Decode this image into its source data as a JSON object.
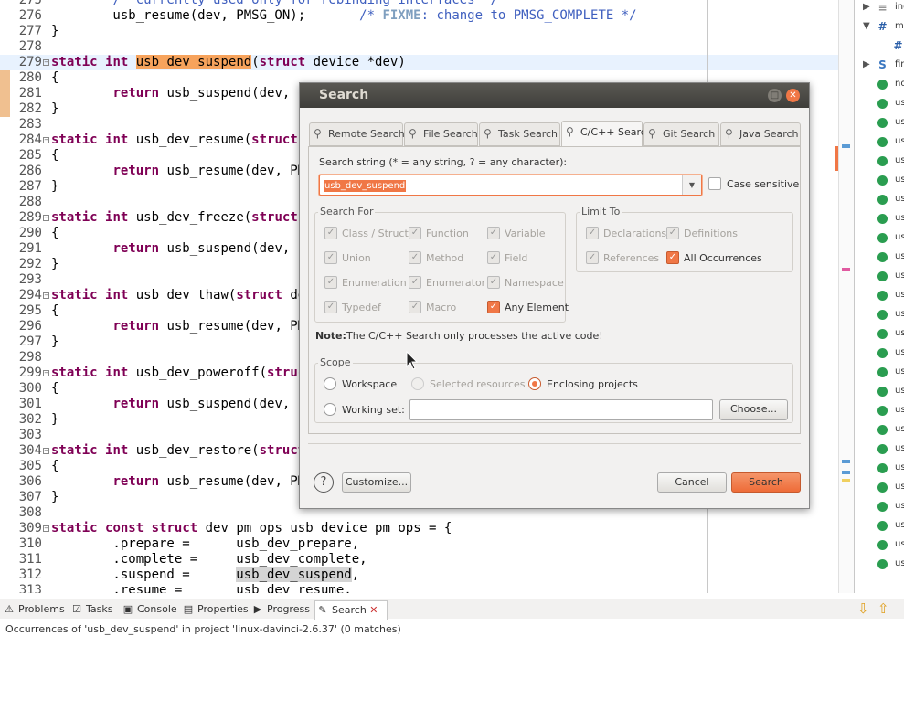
{
  "editor": {
    "lines": [
      {
        "n": "275",
        "code": "        /* currently used only for rebinding interfaces */"
      },
      {
        "n": "276",
        "code": "        usb_resume(dev, PMSG_ON);       /* FIXME: change to PMSG_COMPLETE */"
      },
      {
        "n": "277",
        "code": "}"
      },
      {
        "n": "278",
        "code": ""
      },
      {
        "n": "279",
        "code": "static int usb_dev_suspend(struct device *dev)"
      },
      {
        "n": "280",
        "code": "{"
      },
      {
        "n": "281",
        "code": "        return usb_suspend(dev, PM"
      },
      {
        "n": "282",
        "code": "}"
      },
      {
        "n": "283",
        "code": ""
      },
      {
        "n": "284",
        "code": "static int usb_dev_resume(struct d"
      },
      {
        "n": "285",
        "code": "{"
      },
      {
        "n": "286",
        "code": "        return usb_resume(dev, PMS"
      },
      {
        "n": "287",
        "code": "}"
      },
      {
        "n": "288",
        "code": ""
      },
      {
        "n": "289",
        "code": "static int usb_dev_freeze(struct d"
      },
      {
        "n": "290",
        "code": "{"
      },
      {
        "n": "291",
        "code": "        return usb_suspend(dev, PM"
      },
      {
        "n": "292",
        "code": "}"
      },
      {
        "n": "293",
        "code": ""
      },
      {
        "n": "294",
        "code": "static int usb_dev_thaw(struct dev"
      },
      {
        "n": "295",
        "code": "{"
      },
      {
        "n": "296",
        "code": "        return usb_resume(dev, PMS"
      },
      {
        "n": "297",
        "code": "}"
      },
      {
        "n": "298",
        "code": ""
      },
      {
        "n": "299",
        "code": "static int usb_dev_poweroff(struct"
      },
      {
        "n": "300",
        "code": "{"
      },
      {
        "n": "301",
        "code": "        return usb_suspend(dev, PM"
      },
      {
        "n": "302",
        "code": "}"
      },
      {
        "n": "303",
        "code": ""
      },
      {
        "n": "304",
        "code": "static int usb_dev_restore(struct"
      },
      {
        "n": "305",
        "code": "{"
      },
      {
        "n": "306",
        "code": "        return usb_resume(dev, PMS"
      },
      {
        "n": "307",
        "code": "}"
      },
      {
        "n": "308",
        "code": ""
      },
      {
        "n": "309",
        "code": "static const struct dev_pm_ops usb_device_pm_ops = {"
      },
      {
        "n": "310",
        "code": "        .prepare =      usb_dev_prepare,"
      },
      {
        "n": "311",
        "code": "        .complete =     usb_dev_complete,"
      },
      {
        "n": "312",
        "code": "        .suspend =      usb_dev_suspend,"
      },
      {
        "n": "313",
        "code": "        .resume =       usb_dev_resume,"
      }
    ],
    "current_line": "279",
    "highlight_word": "usb_dev_suspend"
  },
  "outline": {
    "items": [
      {
        "label": "inc",
        "icon": "include-icon"
      },
      {
        "label": "ma",
        "icon": "macro-icon"
      },
      {
        "label": "#",
        "icon": "define-icon"
      },
      {
        "label": "fir",
        "icon": "struct-icon"
      },
      {
        "label": "no",
        "icon": "function-icon"
      },
      {
        "label": "us",
        "icon": "function-icon"
      },
      {
        "label": "us",
        "icon": "function-icon"
      },
      {
        "label": "us",
        "icon": "function-icon"
      },
      {
        "label": "us",
        "icon": "function-icon"
      },
      {
        "label": "us",
        "icon": "function-icon"
      },
      {
        "label": "us",
        "icon": "function-icon"
      },
      {
        "label": "us",
        "icon": "function-icon"
      },
      {
        "label": "us",
        "icon": "function-icon"
      },
      {
        "label": "us",
        "icon": "function-icon"
      },
      {
        "label": "us",
        "icon": "function-icon"
      },
      {
        "label": "us",
        "icon": "function-icon"
      },
      {
        "label": "us",
        "icon": "function-icon"
      },
      {
        "label": "us",
        "icon": "function-icon"
      },
      {
        "label": "us",
        "icon": "function-icon"
      },
      {
        "label": "us",
        "icon": "function-icon"
      },
      {
        "label": "us",
        "icon": "function-icon"
      },
      {
        "label": "us",
        "icon": "function-icon"
      },
      {
        "label": "us",
        "icon": "function-icon"
      },
      {
        "label": "us",
        "icon": "function-icon"
      },
      {
        "label": "us",
        "icon": "function-icon"
      },
      {
        "label": "us",
        "icon": "function-icon"
      },
      {
        "label": "us",
        "icon": "function-icon"
      },
      {
        "label": "us",
        "icon": "function-icon"
      },
      {
        "label": "us",
        "icon": "function-icon"
      },
      {
        "label": "us",
        "icon": "function-icon"
      }
    ]
  },
  "bottom_tabs": [
    {
      "label": "Problems",
      "icon": "problems-icon"
    },
    {
      "label": "Tasks",
      "icon": "tasks-icon"
    },
    {
      "label": "Console",
      "icon": "console-icon"
    },
    {
      "label": "Properties",
      "icon": "properties-icon"
    },
    {
      "label": "Progress",
      "icon": "progress-icon"
    },
    {
      "label": "Search",
      "icon": "search-icon",
      "active": true
    }
  ],
  "status_text": "Occurrences of 'usb_dev_suspend' in project 'linux-davinci-2.6.37' (0 matches)",
  "dialog": {
    "title": "Search",
    "tabs": [
      {
        "label": "Remote Search"
      },
      {
        "label": "File Search"
      },
      {
        "label": "Task Search"
      },
      {
        "label": "C/C++ Search",
        "active": true
      },
      {
        "label": "Git Search"
      },
      {
        "label": "Java Search"
      }
    ],
    "search_label": "Search string (* = any string, ? = any character):",
    "search_value": "usb_dev_suspend",
    "case_sensitive_label": "Case sensitive",
    "search_for_title": "Search For",
    "search_for": [
      {
        "label": "Class / Struct",
        "checked": true
      },
      {
        "label": "Function",
        "checked": true
      },
      {
        "label": "Variable",
        "checked": true
      },
      {
        "label": "Union",
        "checked": true
      },
      {
        "label": "Method",
        "checked": true
      },
      {
        "label": "Field",
        "checked": true
      },
      {
        "label": "Enumeration",
        "checked": true
      },
      {
        "label": "Enumerator",
        "checked": true
      },
      {
        "label": "Namespace",
        "checked": true
      },
      {
        "label": "Typedef",
        "checked": true
      },
      {
        "label": "Macro",
        "checked": true
      },
      {
        "label": "Any Element",
        "checked": true
      }
    ],
    "limit_to_title": "Limit To",
    "limit_to": [
      {
        "label": "Declarations",
        "checked": true
      },
      {
        "label": "Definitions",
        "checked": true
      },
      {
        "label": "References",
        "checked": true
      },
      {
        "label": "All Occurrences",
        "checked": true
      }
    ],
    "note_label": "Note:",
    "note_text": "The C/C++ Search only processes the active code!",
    "scope_title": "Scope",
    "scope_workspace": "Workspace",
    "scope_selected": "Selected resources",
    "scope_enclosing": "Enclosing projects",
    "scope_working_set": "Working set:",
    "working_set_value": "",
    "choose_label": "Choose...",
    "customize_label": "Customize...",
    "cancel_label": "Cancel",
    "search_label_btn": "Search",
    "help_glyph": "?"
  },
  "colors": {
    "accent": "#f07746",
    "keyword": "#7f0055",
    "comment": "#3f5fbf"
  }
}
